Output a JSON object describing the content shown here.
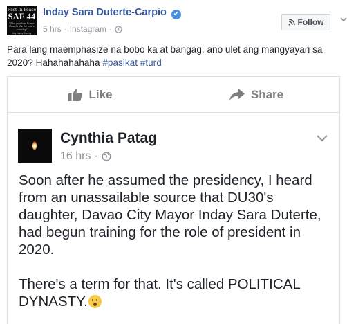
{
  "post": {
    "author": "Inday Sara Duterte-Carpio",
    "timestamp": "5 hrs",
    "source": "Instagram",
    "separator": "·",
    "text": "Para lang maemphasize na bobo ka at bangag, ano ulet ang mangyayari sa 2020? Hahahahahaha ",
    "hashtags": [
      "#pasikat",
      "#turd"
    ],
    "follow_label": "Follow",
    "avatar": {
      "top": "Rest In Peace",
      "main": "SAF 44",
      "quote": "\"The greatest honor thou to die for one's country\"",
      "sig": "Ibby Nancy Country"
    }
  },
  "actions": {
    "like_label": "Like",
    "share_label": "Share"
  },
  "shared": {
    "author": "Cynthia Patag",
    "timestamp": "16 hrs",
    "separator": "·",
    "paragraph1": "Soon after he assumed the presidency, I heard from an unassailable source that DU30's daughter, Davao City Mayor Inday Sara Duterte, had begun training for the role of president in 2020.",
    "paragraph2": "There's a term for that.  It's called POLITICAL DYNASTY."
  },
  "colors": {
    "link": "#365899",
    "text": "#1d2129",
    "muted": "#90949c",
    "verified": "#4a90e2",
    "action_gray": "#7f7f7f"
  },
  "icons": [
    "verified-badge-icon",
    "globe-icon",
    "rss-icon",
    "chevron-down-icon",
    "thumbs-up-icon",
    "share-arrow-icon",
    "hushed-face-emoji-icon"
  ]
}
